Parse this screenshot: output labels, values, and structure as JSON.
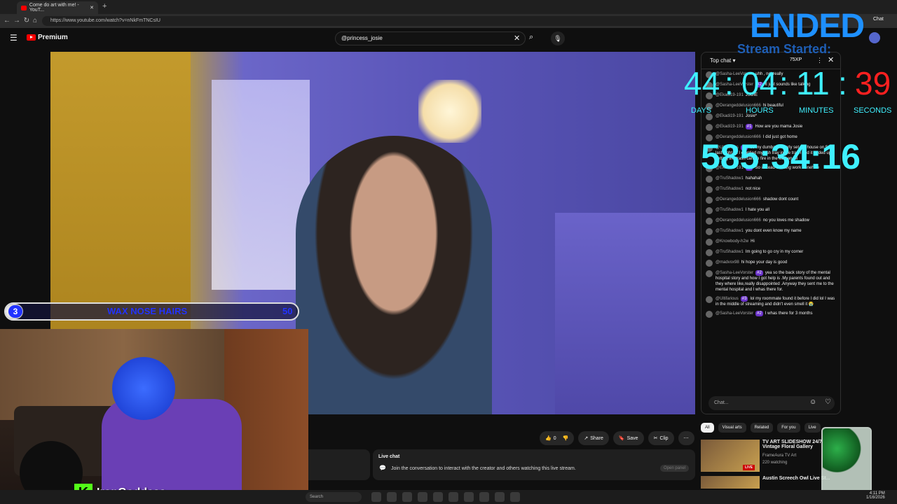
{
  "browser": {
    "tab_title": "Come do art with me! - YouT...",
    "url": "https://www.youtube.com/watch?v=nNkFmTNCsIU",
    "chat_tab": "Chat"
  },
  "youtube": {
    "logo": "Premium",
    "search_value": "@princess_josie"
  },
  "overlay": {
    "goal_count": "3",
    "goal_label": "WAX NOSE HAIRS",
    "goal_target": "50",
    "goal_progress": 0.06,
    "streamer_name": "IronGoddess",
    "timer_status": "ENDED",
    "timer_title": "Stream Started:",
    "days": "44",
    "hours": "04",
    "minutes": "11",
    "seconds": "39",
    "labels": [
      "DAYS",
      "HOURS",
      "MINUTES",
      "SECONDS"
    ],
    "uptime": "585:34:16"
  },
  "actions": {
    "like_count": "0",
    "share": "Share",
    "save": "Save",
    "clip": "Clip"
  },
  "live_chat_box": {
    "title": "Live chat",
    "desc": "Join the conversation to interact with the creator and others watching this live stream.",
    "open_button": "Open panel"
  },
  "chat": {
    "header": "Top chat",
    "xp": "75XP",
    "input_placeholder": "Chat...",
    "messages": [
      {
        "author": "@Sasha-LeeVorster",
        "badge": "",
        "text": "uhh , not really"
      },
      {
        "author": "@Sasha-LeeVorster",
        "badge": "#2",
        "text": "it just sounds like talking"
      },
      {
        "author": "@Ekadi19-191",
        "badge": "",
        "text": "JSOIE"
      },
      {
        "author": "@Derangeddelusion666",
        "badge": "",
        "text": "hi beautiful"
      },
      {
        "author": "@Ekadi19-191",
        "badge": "",
        "text": "Josie*"
      },
      {
        "author": "@Ekadi19-191",
        "badge": "#1",
        "text": "How are you mama Josie"
      },
      {
        "author": "@Derangeddelusion666",
        "badge": "",
        "text": "I did just got home"
      },
      {
        "author": "@Ultifarious",
        "badge": "#3",
        "text": "so my dumbass nearly set my house on fire last night lol I emptied my ash tray in the trash and it ended up setting the trash can on fire in the kitchen lol"
      },
      {
        "author": "@Ekadi19-191",
        "badge": "#1",
        "text": "So instead of doing work Imnehrre"
      },
      {
        "author": "@TruShadow1",
        "badge": "",
        "text": "hahahah"
      },
      {
        "author": "@TruShadow1",
        "badge": "",
        "text": "not nice"
      },
      {
        "author": "@Derangeddelusion666",
        "badge": "",
        "text": "shadow dont count"
      },
      {
        "author": "@TruShadow1",
        "badge": "",
        "text": "I hate you all"
      },
      {
        "author": "@Derangeddelusion666",
        "badge": "",
        "text": "no you loves me shadow"
      },
      {
        "author": "@TruShadow1",
        "badge": "",
        "text": "you dont even know my name"
      },
      {
        "author": "@Knowbody-h2w",
        "badge": "",
        "text": "Hi"
      },
      {
        "author": "@TruShadow1",
        "badge": "",
        "text": "Im going to go cry in my corner"
      },
      {
        "author": "@madvox98",
        "badge": "",
        "text": "hi hope your day is good"
      },
      {
        "author": "@Sasha-LeeVorster",
        "badge": "#2",
        "text": "yea so the back story of the mental hospital story and how I got help is .My parents found out and they where like,really disappointed .Anyway they sent me to the mental hospital and I whas there for."
      },
      {
        "author": "@Ultifarious",
        "badge": "#3",
        "text": "lol my roommate found it before I did lol I was in the middle of streaming and didn't even smell it 😭"
      },
      {
        "author": "@Sasha-LeeVorster",
        "badge": "#2",
        "text": "I whas there for 3 months"
      }
    ]
  },
  "recommendations": {
    "chips": [
      "All",
      "Visual arts",
      "Related",
      "For you",
      "Live"
    ],
    "items": [
      {
        "title": "TV ART SLIDESHOW 24/7 Vintage Floral Gallery",
        "channel": "FrameAura TV Art",
        "views": "220 watching",
        "live": "LIVE"
      },
      {
        "title": "Austin Screech Owl Live St...",
        "channel": "",
        "views": "",
        "live": ""
      }
    ]
  },
  "taskbar": {
    "search": "Search",
    "time": "4:11 PM",
    "date": "1/16/2026"
  }
}
